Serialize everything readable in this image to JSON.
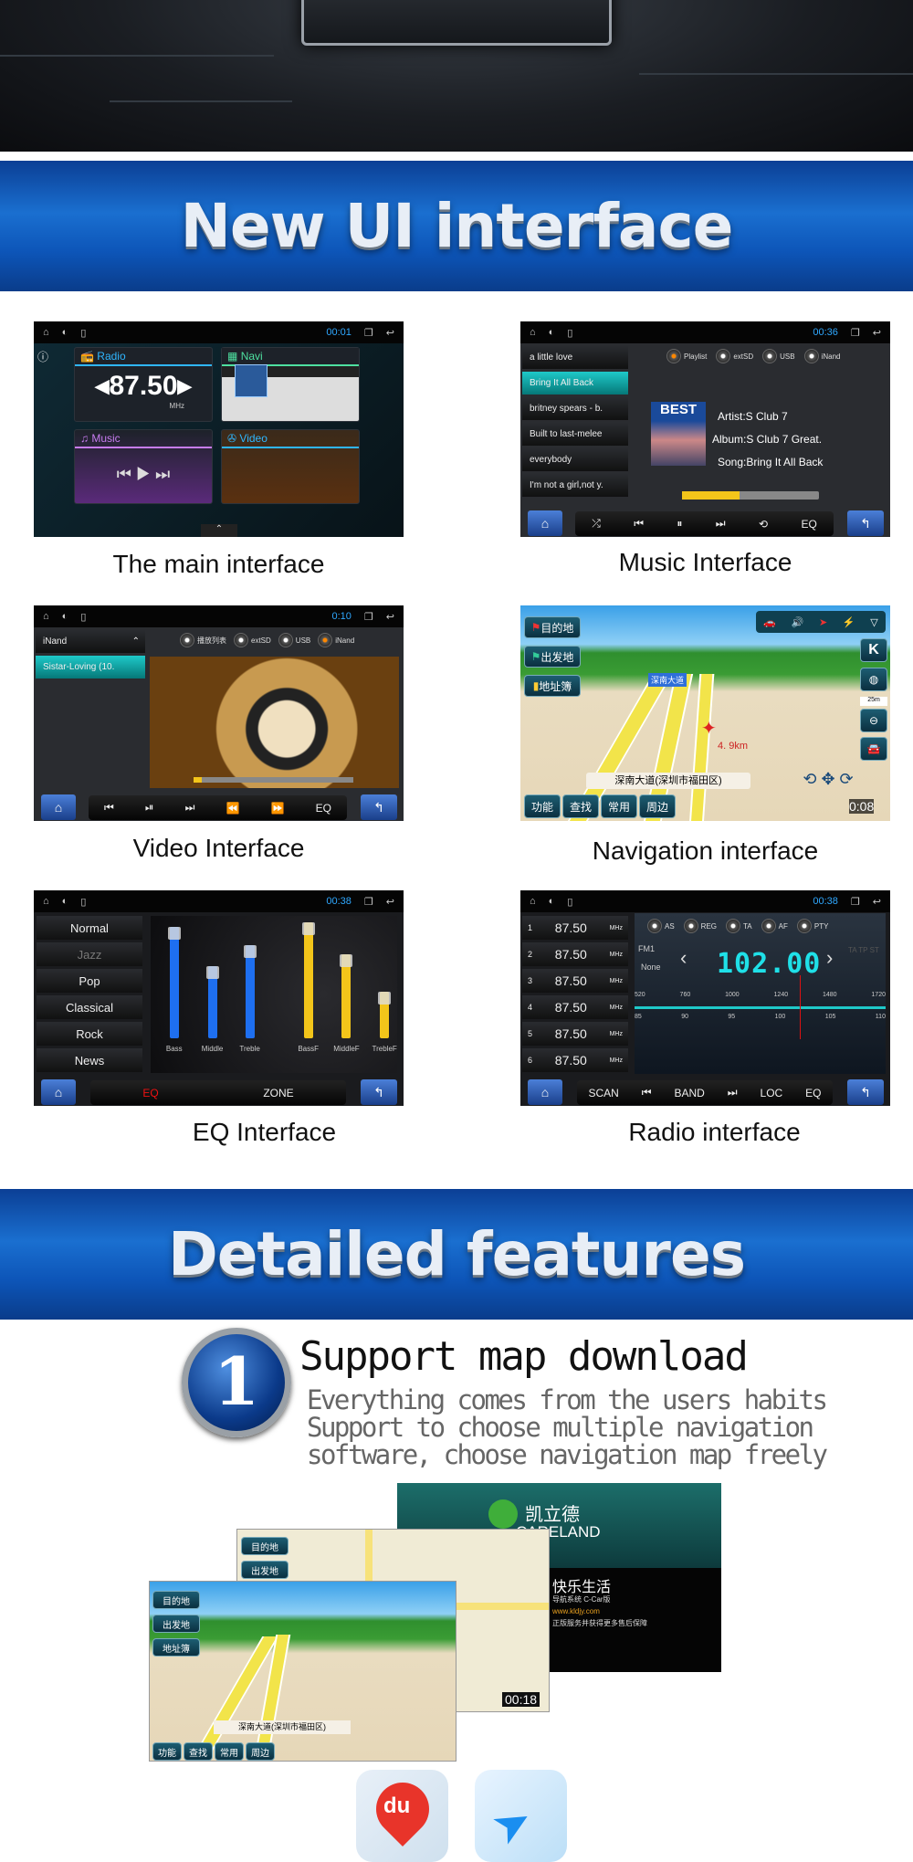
{
  "banners": {
    "ui": "New UI interface",
    "features": "Detailed features"
  },
  "status_bar": {
    "main_time": "00:01",
    "music_time": "00:36",
    "video_time": "0:10",
    "eq_time": "00:38",
    "radio_time": "00:38"
  },
  "main_screen": {
    "caption": "The main interface",
    "tiles": {
      "radio": "Radio",
      "navi": "Navi",
      "music": "Music",
      "video": "Video"
    },
    "frequency": "87.50",
    "unit": "MHz"
  },
  "music_screen": {
    "caption": "Music Interface",
    "playlist": [
      "a little love",
      "Bring It All Back",
      "britney spears - b.",
      "Built to last-melee",
      "everybody",
      "I'm not a girl,not y."
    ],
    "selected_index": 1,
    "sources": [
      "Playlist",
      "extSD",
      "USB",
      "iNand"
    ],
    "album_art_text": "BEST",
    "artist": "Artist:S Club 7",
    "album": "Album:S Club 7 Great.",
    "song": "Song:Bring It All Back",
    "progress": 0.42,
    "controls": {
      "eq": "EQ"
    }
  },
  "video_screen": {
    "caption": "Video Interface",
    "source": "iNand",
    "file": "Sistar-Loving (10.",
    "sources": [
      "播放列表",
      "extSD",
      "USB",
      "iNand"
    ],
    "progress": 0.05,
    "controls": {
      "eq": "EQ"
    }
  },
  "nav_screen": {
    "caption": "Navigation interface",
    "left_buttons": [
      "目的地",
      "出发地",
      "地址簿"
    ],
    "bottom_buttons": [
      "功能",
      "查找",
      "常用",
      "周边"
    ],
    "road_sign": "深南大道",
    "street": "深南大道(深圳市福田区)",
    "distance": "4. 9km",
    "scale": "25m",
    "time": "0:08"
  },
  "eq_screen": {
    "caption": "EQ Interface",
    "presets": [
      "Normal",
      "Jazz",
      "Pop",
      "Classical",
      "Rock",
      "News"
    ],
    "sliders": [
      {
        "label": "Bass",
        "level": 0.95,
        "color": "#1e6ff0"
      },
      {
        "label": "Middle",
        "level": 0.62,
        "color": "#1e6ff0"
      },
      {
        "label": "Treble",
        "level": 0.8,
        "color": "#1e6ff0"
      },
      {
        "label": "BassF",
        "level": 0.99,
        "color": "#f3c51a"
      },
      {
        "label": "MiddleF",
        "level": 0.72,
        "color": "#f3c51a"
      },
      {
        "label": "TrebleF",
        "level": 0.4,
        "color": "#f3c51a"
      }
    ],
    "tabs": {
      "eq": "EQ",
      "zone": "ZONE"
    }
  },
  "radio_screen": {
    "caption": "Radio interface",
    "presets": [
      {
        "n": "1",
        "f": "87.50"
      },
      {
        "n": "2",
        "f": "87.50"
      },
      {
        "n": "3",
        "f": "87.50"
      },
      {
        "n": "4",
        "f": "87.50"
      },
      {
        "n": "5",
        "f": "87.50"
      },
      {
        "n": "6",
        "f": "87.50"
      }
    ],
    "unit": "MHz",
    "options": [
      "AS",
      "REG",
      "TA",
      "AF",
      "PTY"
    ],
    "band": "FM1",
    "pty": "None",
    "frequency": "102.00",
    "flags": "TA TP ST",
    "am_scale": [
      "520",
      "760",
      "1000",
      "1240",
      "1480",
      "1720"
    ],
    "fm_scale": [
      "85",
      "90",
      "95",
      "100",
      "105",
      "110"
    ],
    "controls": {
      "scan": "SCAN",
      "band": "BAND",
      "loc": "LOC",
      "eq": "EQ"
    }
  },
  "feature1": {
    "number": "1",
    "title": "Support map download",
    "lines": [
      "Everything comes from the users habits",
      "Support to choose multiple navigation",
      "software, choose navigation map freely"
    ],
    "kareland": {
      "cn": "凯立德",
      "en": "CARELAND",
      "slogan": "快乐生活",
      "sub": "导航系统 C-Car版",
      "url": "www.kldjy.com",
      "note": "正版服务并获得更多售后保障"
    },
    "map_time": "00:18"
  },
  "apps": {
    "baidu": "du"
  }
}
